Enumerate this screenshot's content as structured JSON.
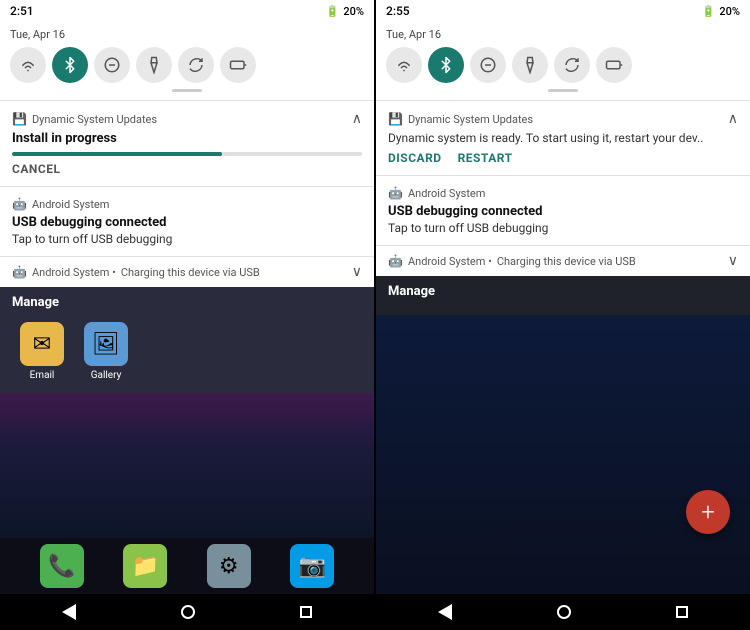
{
  "left_panel": {
    "time": "2:51",
    "date": "Tue, Apr 16",
    "battery": "20%",
    "quick_settings": {
      "icons": [
        "wifi",
        "bluetooth",
        "dnd",
        "flashlight",
        "rotate",
        "battery"
      ]
    },
    "notifications": [
      {
        "app": "Dynamic System Updates",
        "title": "Install in progress",
        "type": "progress",
        "progress": 60,
        "action": "CANCEL"
      },
      {
        "app": "Android System",
        "title": "USB debugging connected",
        "body": "Tap to turn off USB debugging"
      },
      {
        "app": "Android System",
        "subtitle": "Charging this device via USB",
        "collapsed": true
      }
    ],
    "manage_label": "Manage",
    "apps": [
      {
        "name": "Email",
        "icon": "✉"
      },
      {
        "name": "Gallery",
        "icon": "🖼"
      }
    ],
    "dock": [
      {
        "name": "Phone",
        "icon": "📞"
      },
      {
        "name": "Files",
        "icon": "📁"
      },
      {
        "name": "Settings",
        "icon": "⚙"
      },
      {
        "name": "Camera",
        "icon": "📷"
      }
    ]
  },
  "right_panel": {
    "time": "2:55",
    "date": "Tue, Apr 16",
    "battery": "20%",
    "quick_settings": {
      "icons": [
        "wifi",
        "bluetooth",
        "dnd",
        "flashlight",
        "rotate",
        "battery"
      ]
    },
    "notifications": [
      {
        "app": "Dynamic System Updates",
        "body": "Dynamic system is ready. To start using it, restart your dev..",
        "actions": [
          "DISCARD",
          "RESTART"
        ]
      },
      {
        "app": "Android System",
        "title": "USB debugging connected",
        "body": "Tap to turn off USB debugging"
      },
      {
        "app": "Android System",
        "subtitle": "Charging this device via USB",
        "collapsed": true
      }
    ],
    "manage_label": "Manage",
    "fab_icon": "+"
  }
}
